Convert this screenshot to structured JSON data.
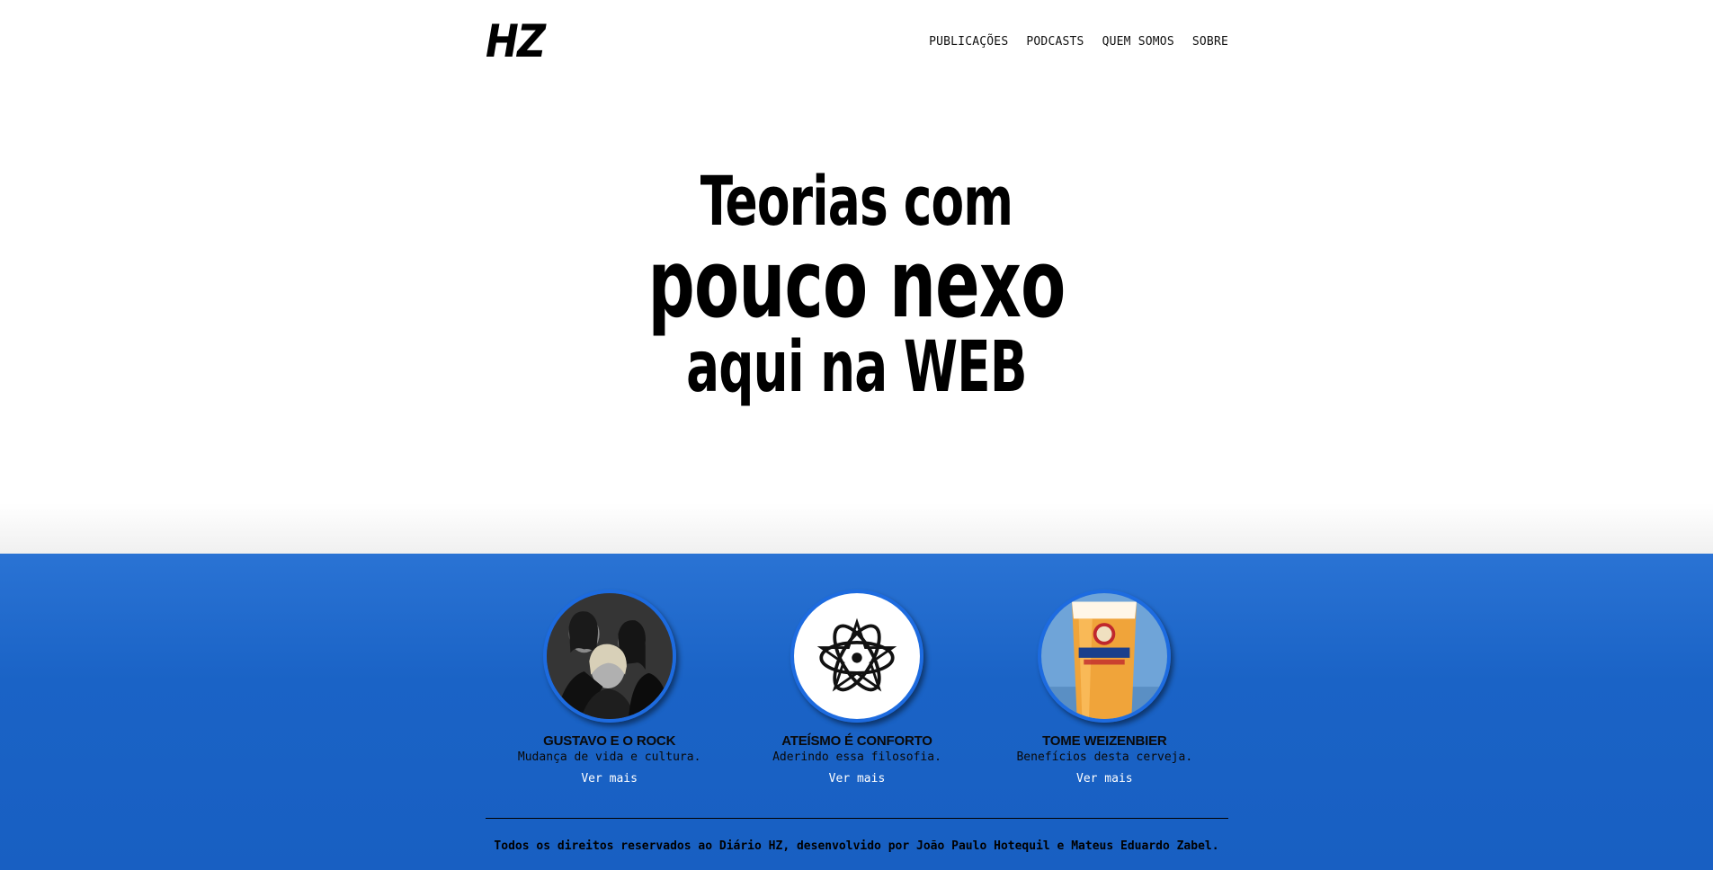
{
  "header": {
    "logo": "HZ",
    "nav": [
      {
        "label": "PUBLICAÇÕES"
      },
      {
        "label": "PODCASTS"
      },
      {
        "label": "QUEM SOMOS"
      },
      {
        "label": "SOBRE"
      }
    ]
  },
  "hero": {
    "line1": "Teorias com",
    "line2": "pouco nexo",
    "line3": "aqui na WEB"
  },
  "cards": [
    {
      "title": "GUSTAVO E O ROCK",
      "description": "Mudança de vida e cultura.",
      "link": "Ver mais",
      "image": "band-photo"
    },
    {
      "title": "ATEÍSMO É CONFORTO",
      "description": "Aderindo essa filosofia.",
      "link": "Ver mais",
      "image": "atheism-symbol"
    },
    {
      "title": "TOME WEIZENBIER",
      "description": "Benefícios desta cerveja.",
      "link": "Ver mais",
      "image": "beer-glass"
    }
  ],
  "footer": {
    "text": "Todos os direitos reservados ao Diário HZ, desenvolvido por João Paulo Hotequil e Mateus Eduardo Zabel."
  },
  "colors": {
    "accent_blue": "#1a63c6",
    "ring_blue": "#1d6be0",
    "link_white": "#ffffff"
  }
}
